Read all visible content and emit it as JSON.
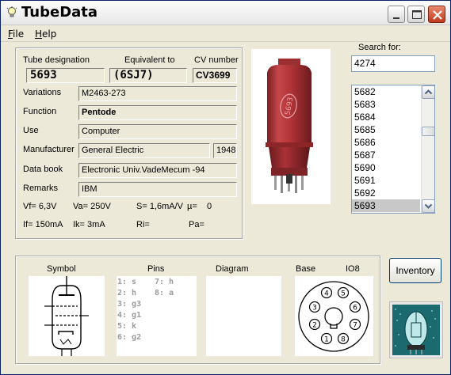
{
  "window": {
    "title": "TubeData"
  },
  "menu": {
    "file": "File",
    "help": "Help"
  },
  "tube": {
    "designation_label": "Tube designation",
    "designation": "5693",
    "equivalent_label": "Equivalent to",
    "equivalent": "(6SJ7)",
    "cv_label": "CV number",
    "cv": "CV3699",
    "variations_label": "Variations",
    "variations": "M2463-273",
    "function_label": "Function",
    "function": "Pentode",
    "use_label": "Use",
    "use": "Computer",
    "manufacturer_label": "Manufacturer",
    "manufacturer": "General Electric",
    "year": "1948",
    "databook_label": "Data book",
    "databook": "Electronic Univ.VadeMecum -94",
    "remarks_label": "Remarks",
    "remarks": "IBM"
  },
  "params": {
    "row1": [
      "Vf= 6,3V",
      "Va= 250V",
      "S= 1,6mA/V",
      "µ=",
      "0"
    ],
    "row2": [
      "If= 150mA",
      "Ik= 3mA",
      "Ri=",
      "Pa="
    ]
  },
  "search": {
    "label": "Search for:",
    "value": "4274"
  },
  "list": {
    "items": [
      "5682",
      "5683",
      "5684",
      "5685",
      "5686",
      "5687",
      "5690",
      "5691",
      "5692",
      "5693"
    ],
    "selected_index": 9
  },
  "photo": {
    "print": "5693"
  },
  "bottom": {
    "symbol_label": "Symbol",
    "pins_label": "Pins",
    "diagram_label": "Diagram",
    "base_label": "Base",
    "base_type": "IO8",
    "pins_left": [
      "1: s",
      "2: h",
      "3: g3",
      "4: g1",
      "5: k",
      "6: g2"
    ],
    "pins_right": [
      "7: h",
      "8: a"
    ],
    "base_pins": [
      "1",
      "2",
      "3",
      "4",
      "5",
      "6",
      "7",
      "8"
    ]
  },
  "buttons": {
    "inventory": "Inventory"
  },
  "colors": {
    "tube_red": "#b4363a",
    "title_text": "#000000",
    "close_red": "#c0391c"
  }
}
